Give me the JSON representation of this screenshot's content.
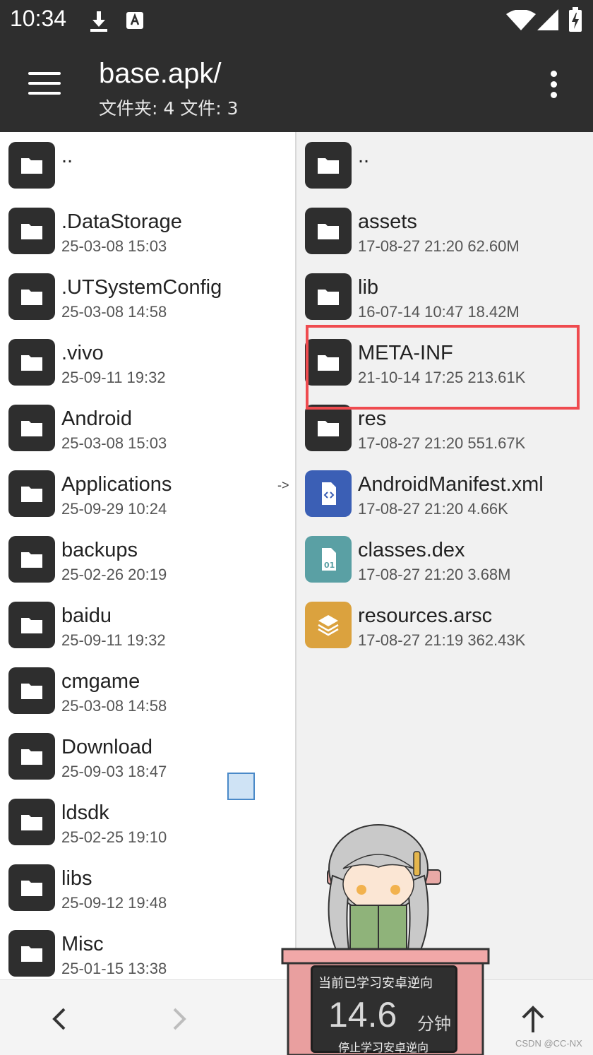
{
  "status_bar": {
    "time": "10:34"
  },
  "header": {
    "title": "base.apk/",
    "subtitle": "文件夹: 4  文件: 3"
  },
  "left_pane": {
    "items": [
      {
        "name": "..",
        "meta": ""
      },
      {
        "name": ".DataStorage",
        "meta": "25-03-08 15:03"
      },
      {
        "name": ".UTSystemConfig",
        "meta": "25-03-08 14:58"
      },
      {
        "name": ".vivo",
        "meta": "25-09-11 19:32"
      },
      {
        "name": "Android",
        "meta": "25-03-08 15:03"
      },
      {
        "name": "Applications",
        "meta": "25-09-29 10:24"
      },
      {
        "name": "backups",
        "meta": "25-02-26 20:19"
      },
      {
        "name": "baidu",
        "meta": "25-09-11 19:32"
      },
      {
        "name": "cmgame",
        "meta": "25-03-08 14:58"
      },
      {
        "name": "Download",
        "meta": "25-09-03 18:47"
      },
      {
        "name": "ldsdk",
        "meta": "25-02-25 19:10"
      },
      {
        "name": "libs",
        "meta": "25-09-12 19:48"
      },
      {
        "name": "Misc",
        "meta": "25-01-15 13:38"
      }
    ],
    "link_arrow": "->"
  },
  "right_pane": {
    "items": [
      {
        "name": "..",
        "meta": "",
        "icon": "folder-icon",
        "color": "#2e2e2e"
      },
      {
        "name": "assets",
        "meta": "17-08-27 21:20  62.60M",
        "icon": "folder-icon",
        "color": "#2e2e2e"
      },
      {
        "name": "lib",
        "meta": "16-07-14 10:47  18.42M",
        "icon": "folder-icon",
        "color": "#2e2e2e"
      },
      {
        "name": "META-INF",
        "meta": "21-10-14 17:25  213.61K",
        "icon": "folder-icon",
        "color": "#2e2e2e"
      },
      {
        "name": "res",
        "meta": "17-08-27 21:20  551.67K",
        "icon": "folder-icon",
        "color": "#2e2e2e"
      },
      {
        "name": "AndroidManifest.xml",
        "meta": "17-08-27 21:20  4.66K",
        "icon": "xml-file-icon",
        "color": "#3b5fb5"
      },
      {
        "name": "classes.dex",
        "meta": "17-08-27 21:20  3.68M",
        "icon": "dex-file-icon",
        "color": "#5aa0a4"
      },
      {
        "name": "resources.arsc",
        "meta": "17-08-27 21:19  362.43K",
        "icon": "layers-file-icon",
        "color": "#dba23e"
      }
    ],
    "highlighted": "META-INF",
    "highlight_color": "#ef4b4f"
  },
  "study_widget": {
    "label": "当前已学习安卓逆向",
    "minutes": "14.6",
    "unit": "分钟",
    "stop_label": "停止学习安卓逆向"
  },
  "watermark": "CSDN @CC-NX"
}
